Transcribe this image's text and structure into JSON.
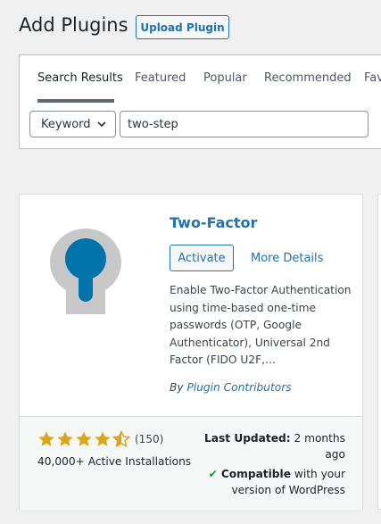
{
  "header": {
    "title": "Add Plugins",
    "upload_label": "Upload Plugin"
  },
  "tabs": [
    {
      "label": "Search Results",
      "active": true
    },
    {
      "label": "Featured",
      "active": false
    },
    {
      "label": "Popular",
      "active": false
    },
    {
      "label": "Recommended",
      "active": false
    },
    {
      "label": "Favorites",
      "active": false
    }
  ],
  "search": {
    "type_selected": "Keyword",
    "query": "two-step"
  },
  "plugin": {
    "name": "Two-Factor",
    "activate_label": "Activate",
    "more_details_label": "More Details",
    "description": "Enable Two-Factor Authentication using time-based one-time passwords (OTP, Google Authenticator), Universal 2nd Factor (FIDO U2F,…",
    "author_prefix": "By",
    "author": "Plugin Contributors",
    "rating_stars": 4.5,
    "rating_count": "(150)",
    "installs": "40,000+ Active Installations",
    "last_updated_label": "Last Updated:",
    "last_updated_value": "2 months ago",
    "compatible_label": "Compatible",
    "compatible_text": "with your version of WordPress"
  },
  "colors": {
    "accent": "#2271b1",
    "star": "#dba617",
    "check": "#00a32a",
    "icon_blue": "#0073aa",
    "icon_grey": "#c8c8c8"
  }
}
